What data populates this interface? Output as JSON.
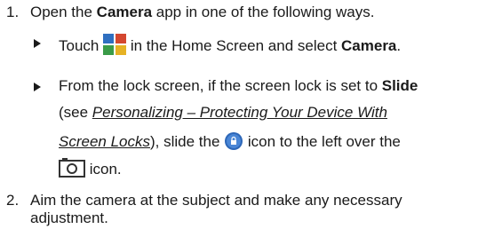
{
  "steps": [
    {
      "num": "1.",
      "text_pre": "Open the ",
      "text_bold": "Camera",
      "text_post": " app in one of the following ways.",
      "bullets": [
        {
          "pre": "Touch ",
          "icon": "apps-grid-icon",
          "post": " in the Home Screen and select ",
          "bold": "Camera",
          "end": "."
        },
        {
          "l1_pre": "From the lock screen, if the screen lock is set to ",
          "l1_bold": "Slide",
          "l2_pre": "(see ",
          "l2_link": "Personalizing – Protecting Your Device With",
          "l3_link": "Screen Locks",
          "l3_mid": "), slide the ",
          "l3_icon": "lock-circle-icon",
          "l3_post": " icon to the left over the",
          "l4_icon": "camera-icon",
          "l4_post": " icon."
        }
      ]
    },
    {
      "num": "2.",
      "line1": "Aim the camera at the subject and make any necessary",
      "line2": "adjustment."
    }
  ],
  "colors": {
    "text": "#1a1a1a",
    "icon_blue": "#2f6fc0",
    "icon_red": "#d4472f",
    "icon_green": "#3a9b48",
    "icon_yellow": "#e6b224"
  }
}
